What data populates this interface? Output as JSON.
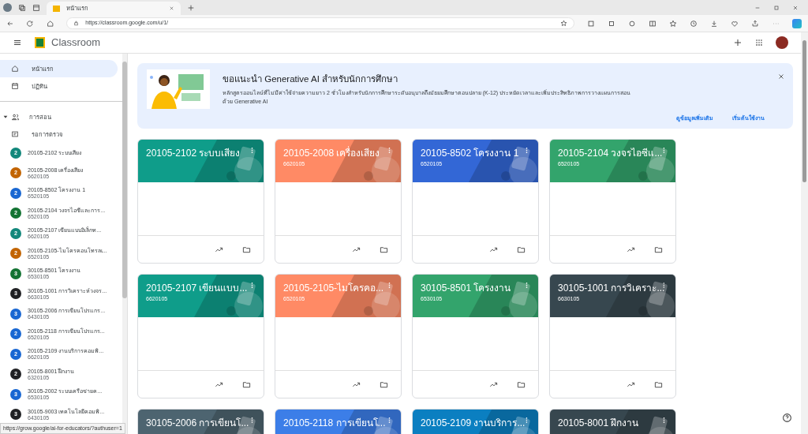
{
  "browser": {
    "tab_title": "หน้าแรก",
    "url": "https://classroom.google.com/u/1/"
  },
  "app": {
    "title": "Classroom"
  },
  "sidebar": {
    "nav": [
      {
        "label": "หน้าแรก",
        "selected": true
      },
      {
        "label": "ปฏิทิน",
        "selected": false
      }
    ],
    "teaching": {
      "label": "การสอน",
      "expanded": true
    },
    "review": {
      "label": "รอการตรวจ"
    },
    "courses": [
      {
        "avatar": "2",
        "color": "#12877b",
        "title": "20105-2102 ระบบเสียง"
      },
      {
        "avatar": "2",
        "color": "#c26401",
        "title": "20105-2008 เครื่องเสียง",
        "subtitle": "6620105"
      },
      {
        "avatar": "2",
        "color": "#1967d2",
        "title": "20105-8502 โครงงาน 1",
        "subtitle": "6520105"
      },
      {
        "avatar": "2",
        "color": "#137333",
        "title": "20105-2104 วงจรไอซีและการ...",
        "subtitle": "6520105"
      },
      {
        "avatar": "2",
        "color": "#12877b",
        "title": "20105-2107 เขียนแบบอิเล็กท...",
        "subtitle": "6620105"
      },
      {
        "avatar": "2",
        "color": "#c26401",
        "title": "20105-2105-ไมโครคอนโทรลเ...",
        "subtitle": "6520105"
      },
      {
        "avatar": "3",
        "color": "#137333",
        "title": "30105-8501 โครงงาน",
        "subtitle": "6530105"
      },
      {
        "avatar": "3",
        "color": "#202124",
        "title": "30105-1001 การวิเคราะห์วงจร...",
        "subtitle": "6630105"
      },
      {
        "avatar": "3",
        "color": "#1967d2",
        "title": "30105-2006 การเขียนโปรแกร...",
        "subtitle": "6430105"
      },
      {
        "avatar": "2",
        "color": "#1967d2",
        "title": "20105-2118 การเขียนโปรแกร...",
        "subtitle": "6520105"
      },
      {
        "avatar": "2",
        "color": "#1967d2",
        "title": "20105-2109 งานบริการคอมพิ...",
        "subtitle": "6620105"
      },
      {
        "avatar": "2",
        "color": "#202124",
        "title": "20105-8001 ฝึกงาน",
        "subtitle": "6320105"
      },
      {
        "avatar": "3",
        "color": "#1967d2",
        "title": "30105-2002 ระบบเครือข่ายค...",
        "subtitle": "6530105"
      },
      {
        "avatar": "3",
        "color": "#202124",
        "title": "30105-9003 เทคโนโลยีคอมพิ...",
        "subtitle": "6430105"
      }
    ]
  },
  "banner": {
    "title": "ขอแนะนำ Generative AI สำหรับนักการศึกษา",
    "text": "หลักสูตรออนไลน์ที่ไม่มีค่าใช้จ่ายความยาว 2 ชั่วโมงสำหรับนักการศึกษาระดับอนุบาลถึงมัธยมศึกษาตอนปลาย (K-12) ประหยัดเวลาและเพิ่มประสิทธิภาพการวางแผนการสอน ด้วย Generative AI",
    "links": [
      "ดูข้อมูลเพิ่มเติม",
      "เริ่มต้นใช้งาน"
    ]
  },
  "classes": [
    {
      "title": "20105-2102 ระบบเสียง",
      "color": "#0f9d8a"
    },
    {
      "title": "20105-2008 เครื่องเสียง",
      "subtitle": "6620105",
      "color": "#ff8a65"
    },
    {
      "title": "20105-8502 โครงงาน 1",
      "subtitle": "6520105",
      "color": "#3367d6"
    },
    {
      "title": "20105-2104 วงจรไอซีแ...",
      "subtitle": "6520105",
      "color": "#33a46c"
    },
    {
      "title": "20105-2107 เขียนแบบ...",
      "subtitle": "6620105",
      "color": "#0f9d8a"
    },
    {
      "title": "20105-2105-ไมโครคอ...",
      "subtitle": "6520105",
      "color": "#ff8a65"
    },
    {
      "title": "30105-8501 โครงงาน",
      "subtitle": "6530105",
      "color": "#33a46c"
    },
    {
      "title": "30105-1001 การวิเคราะ...",
      "subtitle": "6630105",
      "color": "#37474f"
    },
    {
      "title": "30105-2006 การเขียนโ...",
      "color": "#4d6470"
    },
    {
      "title": "20105-2118 การเขียนโ...",
      "color": "#3c7ee8"
    },
    {
      "title": "20105-2109 งานบริการ...",
      "color": "#0b7fc1"
    },
    {
      "title": "20105-8001 ฝึกงาน",
      "color": "#37474f"
    }
  ],
  "status_bar": {
    "url": "https://grow.google/ai-for-educators/?authuser=1"
  }
}
